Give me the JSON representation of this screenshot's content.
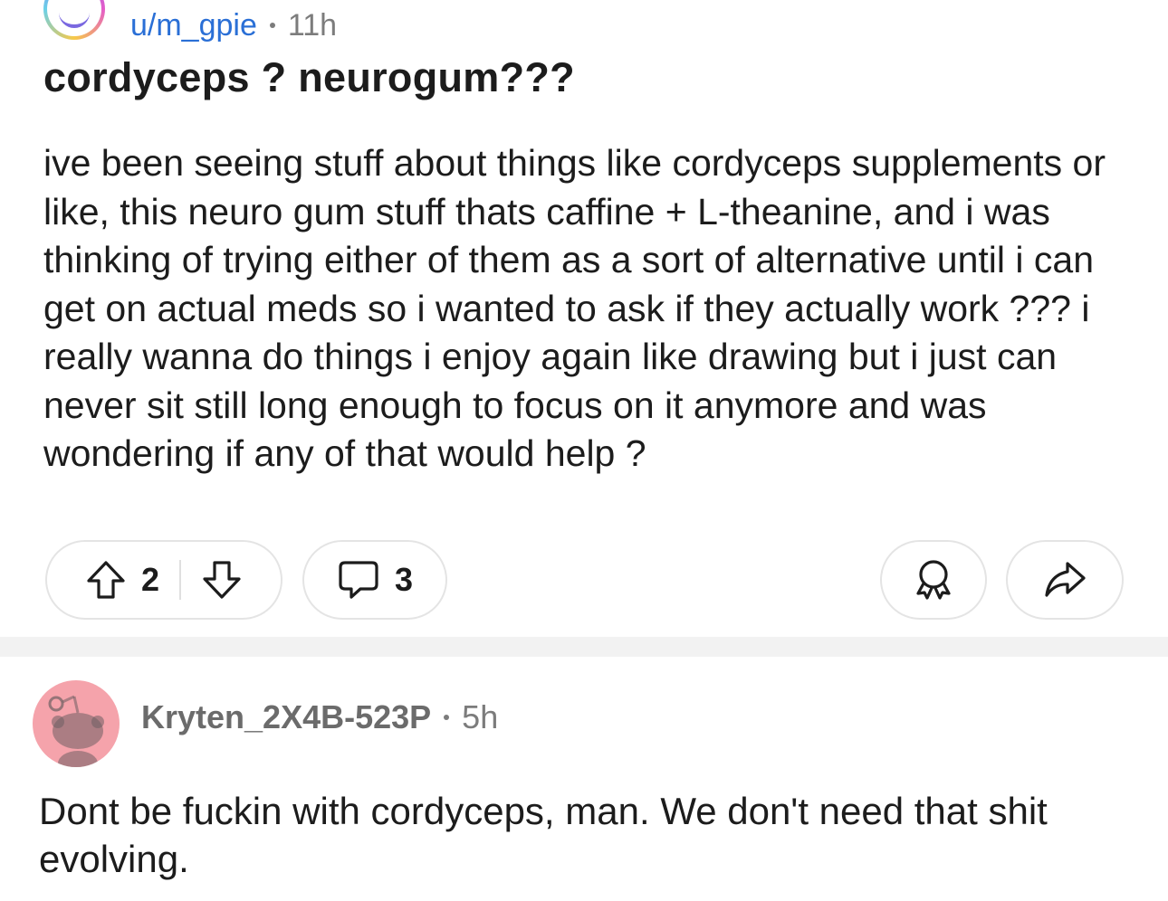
{
  "post": {
    "author": "u/m_gpie",
    "time": "11h",
    "title": "cordyceps ? neurogum???",
    "body": "ive been seeing stuff about things like cordyceps supplements or like, this neuro gum stuff thats caffine + L-theanine, and i was thinking of trying either of them as a sort of alternative until i can get on actual meds so i wanted to ask if they actually work ??? i really wanna do things i enjoy again like drawing but i just can never sit still long enough to focus on it anymore and was wondering if any of that would help ?",
    "upvotes": "2",
    "comments": "3"
  },
  "icons": {
    "upvote": "arrow-up-icon",
    "downvote": "arrow-down-icon",
    "comment": "speech-bubble-icon",
    "award": "award-ribbon-icon",
    "share": "share-arrow-icon"
  },
  "comment": {
    "author": "Kryten_2X4B-523P",
    "time": "5h",
    "body": "Dont be fuckin with cordyceps, man. We don't need that shit evolving."
  },
  "colors": {
    "username_link": "#2a6fd6",
    "comment_avatar_bg": "#f5a3ab",
    "divider": "#f2f2f2"
  }
}
